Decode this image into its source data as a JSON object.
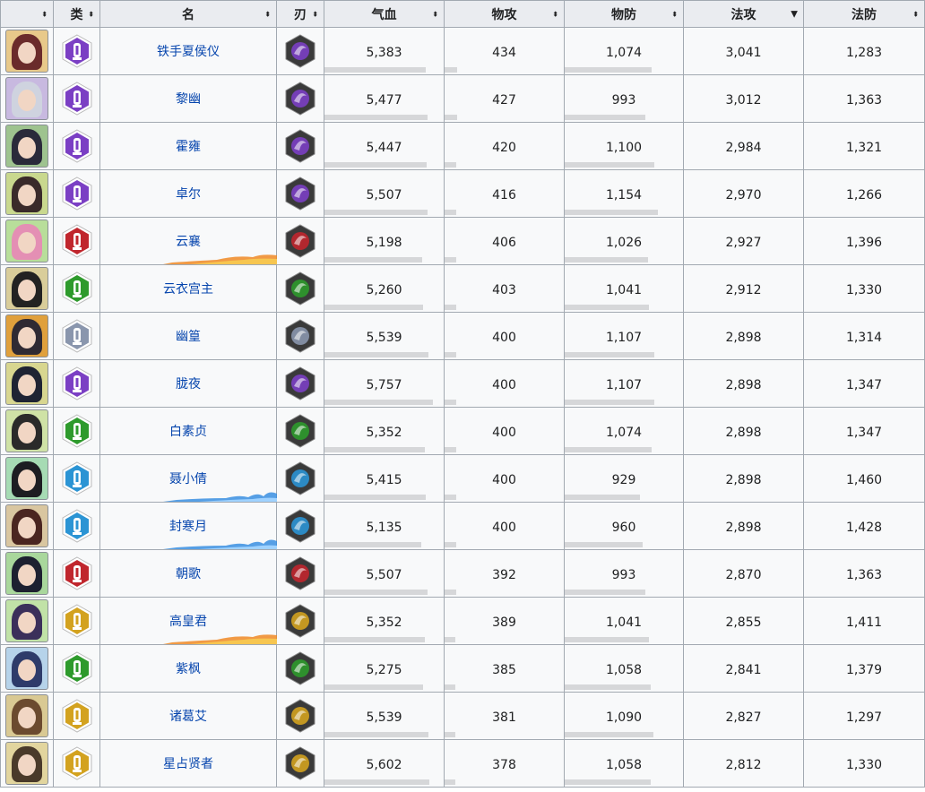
{
  "headers": {
    "avatar": "",
    "type": "类",
    "name": "名",
    "blade": "刃",
    "hp": "气血",
    "patk": "物攻",
    "pdef": "物防",
    "matk": "法攻",
    "mdef": "法防"
  },
  "sort_icons": {
    "both": "⬍",
    "desc": "▼"
  },
  "sorted_column": "法攻",
  "class_colors": {
    "purple": "#7b3fc4",
    "red": "#c0262d",
    "green": "#2e9a2c",
    "silver": "#8a96ad",
    "blue": "#2b94d4",
    "gold": "#d3a21f"
  },
  "rows": [
    {
      "name": "铁手夏侯仪",
      "type_icon": "purple-class-icon",
      "type_color": "purple",
      "blade_icon": "purple-blade-icon",
      "blade_color": "purple",
      "portrait_hair": "#6a2b2b",
      "portrait_bg": "#e8c98a",
      "hp": "5,383",
      "patk": "434",
      "pdef": "1,074",
      "matk": "3,041",
      "mdef": "1,283",
      "hp_v": 5383,
      "patk_v": 434,
      "pdef_v": 1074,
      "deco": ""
    },
    {
      "name": "黎幽",
      "type_icon": "purple-class-icon",
      "type_color": "purple",
      "blade_icon": "purple-blade-icon",
      "blade_color": "purple",
      "portrait_hair": "#cfd3df",
      "portrait_bg": "#c8b9e0",
      "hp": "5,477",
      "patk": "427",
      "pdef": "993",
      "matk": "3,012",
      "mdef": "1,363",
      "hp_v": 5477,
      "patk_v": 427,
      "pdef_v": 993,
      "deco": ""
    },
    {
      "name": "霍雍",
      "type_icon": "purple-class-icon",
      "type_color": "purple",
      "blade_icon": "purple-blade-icon",
      "blade_color": "purple",
      "portrait_hair": "#2a2a3a",
      "portrait_bg": "#9ec38f",
      "hp": "5,447",
      "patk": "420",
      "pdef": "1,100",
      "matk": "2,984",
      "mdef": "1,321",
      "hp_v": 5447,
      "patk_v": 420,
      "pdef_v": 1100,
      "deco": ""
    },
    {
      "name": "卓尔",
      "type_icon": "purple-class-icon",
      "type_color": "purple",
      "blade_icon": "purple-blade-icon",
      "blade_color": "purple",
      "portrait_hair": "#3a2a2a",
      "portrait_bg": "#c9d88e",
      "hp": "5,507",
      "patk": "416",
      "pdef": "1,154",
      "matk": "2,970",
      "mdef": "1,266",
      "hp_v": 5507,
      "patk_v": 416,
      "pdef_v": 1154,
      "deco": ""
    },
    {
      "name": "云襄",
      "type_icon": "red-class-icon",
      "type_color": "red",
      "blade_icon": "red-blade-icon",
      "blade_color": "red",
      "portrait_hair": "#e48fb4",
      "portrait_bg": "#b8de9a",
      "hp": "5,198",
      "patk": "406",
      "pdef": "1,026",
      "matk": "2,927",
      "mdef": "1,396",
      "hp_v": 5198,
      "patk_v": 406,
      "pdef_v": 1026,
      "deco": "fire"
    },
    {
      "name": "云衣宫主",
      "type_icon": "green-class-icon",
      "type_color": "green",
      "blade_icon": "green-blade-icon",
      "blade_color": "green",
      "portrait_hair": "#222222",
      "portrait_bg": "#d9cd9a",
      "hp": "5,260",
      "patk": "403",
      "pdef": "1,041",
      "matk": "2,912",
      "mdef": "1,330",
      "hp_v": 5260,
      "patk_v": 403,
      "pdef_v": 1041,
      "deco": ""
    },
    {
      "name": "幽篁",
      "type_icon": "silver-class-icon",
      "type_color": "silver",
      "blade_icon": "silver-blade-icon",
      "blade_color": "silver",
      "portrait_hair": "#2f2a33",
      "portrait_bg": "#e0a03c",
      "hp": "5,539",
      "patk": "400",
      "pdef": "1,107",
      "matk": "2,898",
      "mdef": "1,314",
      "hp_v": 5539,
      "patk_v": 400,
      "pdef_v": 1107,
      "deco": ""
    },
    {
      "name": "胧夜",
      "type_icon": "purple-class-icon",
      "type_color": "purple",
      "blade_icon": "purple-blade-icon",
      "blade_color": "purple",
      "portrait_hair": "#1f2333",
      "portrait_bg": "#d8d690",
      "hp": "5,757",
      "patk": "400",
      "pdef": "1,107",
      "matk": "2,898",
      "mdef": "1,347",
      "hp_v": 5757,
      "patk_v": 400,
      "pdef_v": 1107,
      "deco": ""
    },
    {
      "name": "白素贞",
      "type_icon": "green-class-icon",
      "type_color": "green",
      "blade_icon": "green-blade-icon",
      "blade_color": "green",
      "portrait_hair": "#2a2a2a",
      "portrait_bg": "#cfe2a6",
      "hp": "5,352",
      "patk": "400",
      "pdef": "1,074",
      "matk": "2,898",
      "mdef": "1,347",
      "hp_v": 5352,
      "patk_v": 400,
      "pdef_v": 1074,
      "deco": ""
    },
    {
      "name": "聂小倩",
      "type_icon": "blue-class-icon",
      "type_color": "blue",
      "blade_icon": "blue-blade-icon",
      "blade_color": "blue",
      "portrait_hair": "#1d1d22",
      "portrait_bg": "#a6dbb4",
      "hp": "5,415",
      "patk": "400",
      "pdef": "929",
      "matk": "2,898",
      "mdef": "1,460",
      "hp_v": 5415,
      "patk_v": 400,
      "pdef_v": 929,
      "deco": "water"
    },
    {
      "name": "封寒月",
      "type_icon": "blue-class-icon",
      "type_color": "blue",
      "blade_icon": "blue-blade-icon",
      "blade_color": "blue",
      "portrait_hair": "#4a2520",
      "portrait_bg": "#d9c6a0",
      "hp": "5,135",
      "patk": "400",
      "pdef": "960",
      "matk": "2,898",
      "mdef": "1,428",
      "hp_v": 5135,
      "patk_v": 400,
      "pdef_v": 960,
      "deco": "water"
    },
    {
      "name": "朝歌",
      "type_icon": "red-class-icon",
      "type_color": "red",
      "blade_icon": "red-blade-icon",
      "blade_color": "red",
      "portrait_hair": "#1d2030",
      "portrait_bg": "#a9d79c",
      "hp": "5,507",
      "patk": "392",
      "pdef": "993",
      "matk": "2,870",
      "mdef": "1,363",
      "hp_v": 5507,
      "patk_v": 392,
      "pdef_v": 993,
      "deco": ""
    },
    {
      "name": "高皇君",
      "type_icon": "gold-class-icon",
      "type_color": "gold",
      "blade_icon": "gold-blade-icon",
      "blade_color": "gold",
      "portrait_hair": "#3b2f5a",
      "portrait_bg": "#c1e2a7",
      "hp": "5,352",
      "patk": "389",
      "pdef": "1,041",
      "matk": "2,855",
      "mdef": "1,411",
      "hp_v": 5352,
      "patk_v": 389,
      "pdef_v": 1041,
      "deco": "fire"
    },
    {
      "name": "紫枫",
      "type_icon": "green-class-icon",
      "type_color": "green",
      "blade_icon": "green-blade-icon",
      "blade_color": "green",
      "portrait_hair": "#2e3b6a",
      "portrait_bg": "#b6d3ea",
      "hp": "5,275",
      "patk": "385",
      "pdef": "1,058",
      "matk": "2,841",
      "mdef": "1,379",
      "hp_v": 5275,
      "patk_v": 385,
      "pdef_v": 1058,
      "deco": ""
    },
    {
      "name": "诸葛艾",
      "type_icon": "gold-class-icon",
      "type_color": "gold",
      "blade_icon": "gold-blade-icon",
      "blade_color": "gold",
      "portrait_hair": "#6b4a2f",
      "portrait_bg": "#d9c993",
      "hp": "5,539",
      "patk": "381",
      "pdef": "1,090",
      "matk": "2,827",
      "mdef": "1,297",
      "hp_v": 5539,
      "patk_v": 381,
      "pdef_v": 1090,
      "deco": ""
    },
    {
      "name": "星占贤者",
      "type_icon": "gold-class-icon",
      "type_color": "gold",
      "blade_icon": "gold-blade-icon",
      "blade_color": "gold",
      "portrait_hair": "#4a3a2a",
      "portrait_bg": "#e2d59e",
      "hp": "5,602",
      "patk": "378",
      "pdef": "1,058",
      "matk": "2,812",
      "mdef": "1,330",
      "hp_v": 5602,
      "patk_v": 378,
      "pdef_v": 1058,
      "deco": ""
    }
  ],
  "bar_scale": {
    "hp_max": 6400,
    "patk_max": 4200,
    "pdef_max": 1470
  }
}
